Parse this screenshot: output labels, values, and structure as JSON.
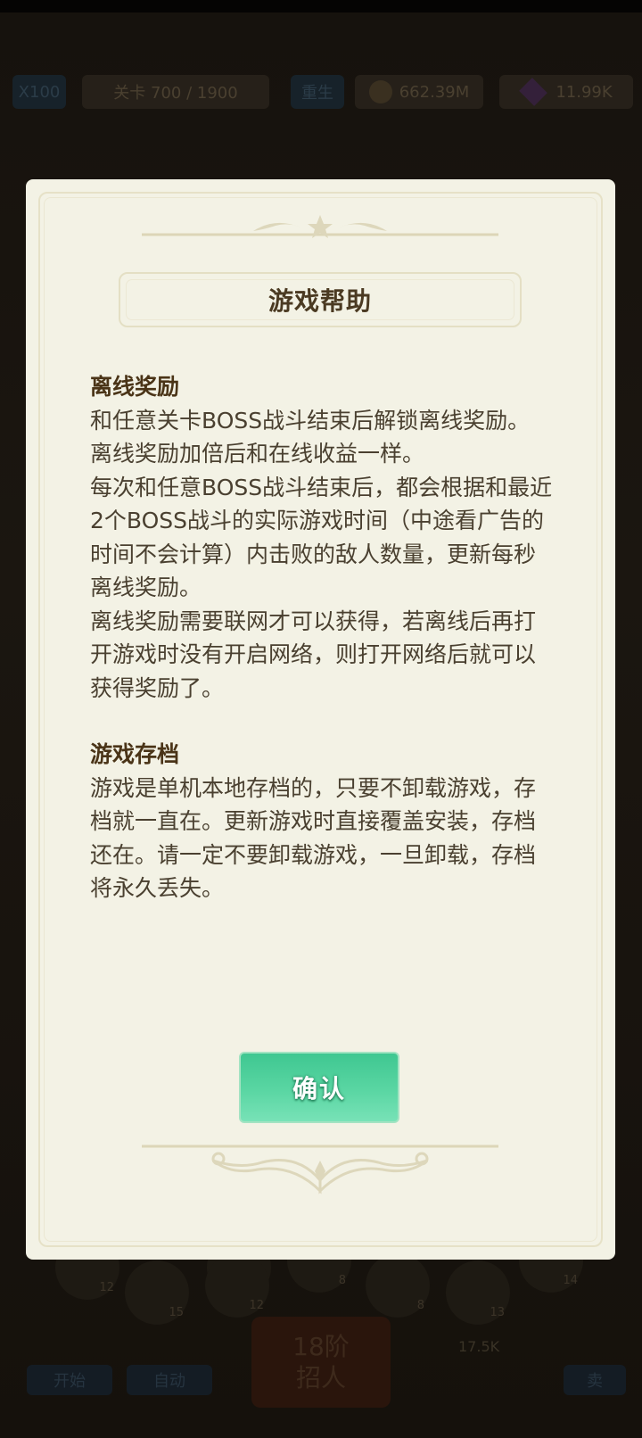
{
  "background": {
    "hud": {
      "multiplier": "X100",
      "stage_label": "关卡 700 / 1900",
      "rebirth_label": "重生",
      "coins": "662.39M",
      "gems": "11.99K"
    },
    "bottom": {
      "slot_levels": [
        "12",
        "12",
        "8",
        "14",
        "15",
        "12",
        "8",
        "13"
      ],
      "left_button": "开始",
      "left_button_2": "自动",
      "center_button_line1": "18阶",
      "center_button_line2": "招人",
      "cost": "17.5K",
      "right_button": "卖"
    }
  },
  "dialog": {
    "title": "游戏帮助",
    "sections": [
      {
        "title": "离线奖励",
        "paragraphs": [
          "和任意关卡BOSS战斗结束后解锁离线奖励。",
          "离线奖励加倍后和在线收益一样。",
          "每次和任意BOSS战斗结束后，都会根据和最近2个BOSS战斗的实际游戏时间（中途看广告的时间不会计算）内击败的敌人数量，更新每秒离线奖励。",
          "离线奖励需要联网才可以获得，若离线后再打开游戏时没有开启网络，则打开网络后就可以获得奖励了。"
        ]
      },
      {
        "title": "游戏存档",
        "paragraphs": [
          "游戏是单机本地存档的，只要不卸载游戏，存档就一直在。更新游戏时直接覆盖安装，存档还在。请一定不要卸载游戏，一旦卸载，存档将永久丢失。"
        ]
      }
    ],
    "confirm_label": "确认"
  },
  "colors": {
    "dialog_bg": "#f3f2e5",
    "title_text": "#4b3a22",
    "body_text": "#4a4030",
    "confirm_green": "#4fd09c"
  }
}
